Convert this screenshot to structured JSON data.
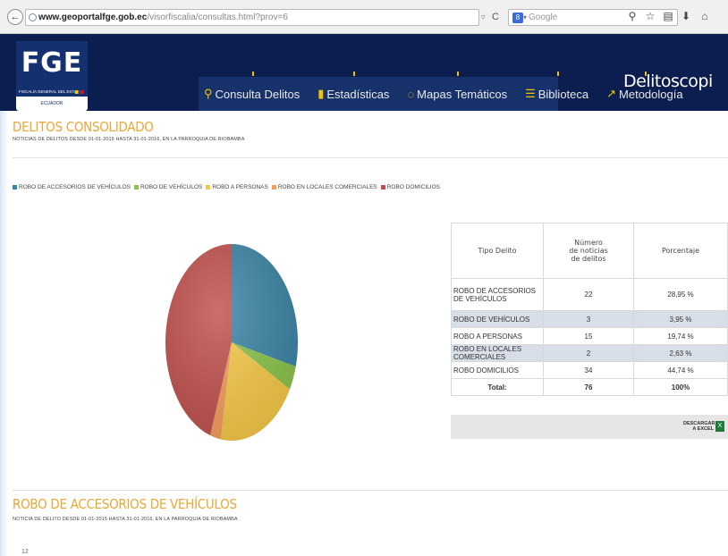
{
  "browser": {
    "back_glyph": "←",
    "url_domain": "www.geoportalfge.gob.ec",
    "url_path": "/visorfiscalia/consultas.html?prov=6",
    "url_prefix": "www.",
    "search_placeholder": "Google",
    "search_logo": "8",
    "reload_glyph": "C",
    "dropdown_glyph": "▿",
    "icons": [
      "search-icon",
      "star-icon",
      "reading-list-icon",
      "download-icon",
      "home-icon"
    ]
  },
  "header": {
    "logo_text": "FGE",
    "logo_subtitle": "FISCALÍA GENERAL DEL ESTADO",
    "logo_country": "ECUADOR",
    "brand_text": "Delitoscopi",
    "nav": [
      {
        "label": "Consulta Delitos",
        "icon": "map-pin-icon",
        "glyph": "⚲"
      },
      {
        "label": "Estadísticas",
        "icon": "bar-chart-icon",
        "glyph": "▮"
      },
      {
        "label": "Mapas Temáticos",
        "icon": "chat-icon",
        "glyph": "◌"
      },
      {
        "label": "Biblioteca",
        "icon": "list-icon",
        "glyph": "☰"
      },
      {
        "label": "Metodología",
        "icon": "share-icon",
        "glyph": "↗"
      }
    ]
  },
  "summary": {
    "title": "DELITOS CONSOLIDADO",
    "subtitle": "NOTICIAS DE DELITOS DESDE 01-01-2015 HASTA 31-01-2016, EN LA PARROQUIA DE RIOBAMBA"
  },
  "legend": [
    {
      "label": "ROBO DE ACCESORIOS DE VEHÍCULOS",
      "color": "#3b84a4"
    },
    {
      "label": "ROBO DE VEHÍCULOS",
      "color": "#8bc34a"
    },
    {
      "label": "ROBO A PERSONAS",
      "color": "#f7c948"
    },
    {
      "label": "ROBO EN LOCALES COMERCIALES",
      "color": "#f39c5a"
    },
    {
      "label": "ROBO DOMICILIOS",
      "color": "#c0504d"
    }
  ],
  "chart_data": {
    "type": "pie",
    "categories": [
      "ROBO DE ACCESORIOS DE VEHÍCULOS",
      "ROBO DE VEHÍCULOS",
      "ROBO A PERSONAS",
      "ROBO EN LOCALES COMERCIALES",
      "ROBO DOMICILIOS"
    ],
    "values": [
      22,
      3,
      15,
      2,
      34
    ],
    "colors": [
      "#3b84a4",
      "#8bc34a",
      "#f7c948",
      "#f39c5a",
      "#c0504d"
    ],
    "title": ""
  },
  "table": {
    "headers": [
      "Tipo Delito",
      "Número de noticias de delitos",
      "Porcentaje"
    ],
    "rows": [
      {
        "tipo": "ROBO DE ACCESORIOS DE VEHÍCULOS",
        "num": "22",
        "pct": "28,95 %"
      },
      {
        "tipo": "ROBO DE VEHÍCULOS",
        "num": "3",
        "pct": "3,95 %"
      },
      {
        "tipo": "ROBO A PERSONAS",
        "num": "15",
        "pct": "19,74 %"
      },
      {
        "tipo": "ROBO EN LOCALES COMERCIALES",
        "num": "2",
        "pct": "2,63 %"
      },
      {
        "tipo": "ROBO DOMICILIOS",
        "num": "34",
        "pct": "44,74 %"
      }
    ],
    "total_label": "Total:",
    "total_num": "76",
    "total_pct": "100%",
    "export_label": "DESCARGAR A EXCEL"
  },
  "detail": {
    "title": "ROBO DE ACCESORIOS DE VEHÍCULOS",
    "subtitle": "NOTICIA DE DELITO DESDE 01-01-2015 HASTA 31-01-2016, EN LA PARROQUIA DE RIOBAMBA",
    "page_number": "12"
  }
}
